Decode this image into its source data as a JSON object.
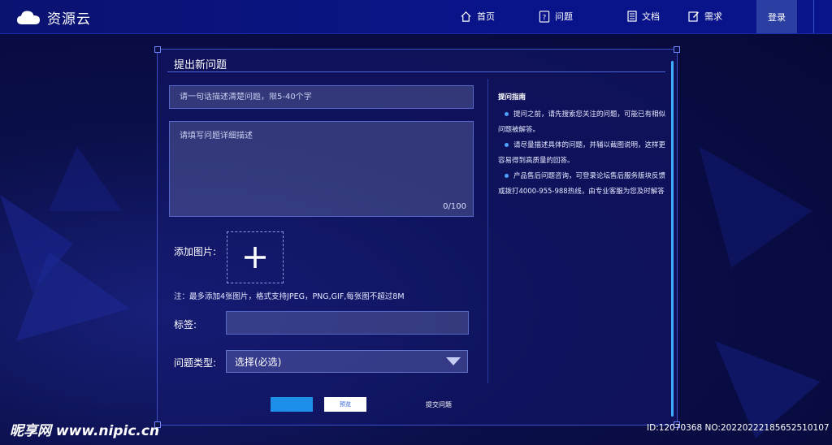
{
  "brand": {
    "name": "资源云"
  },
  "nav": {
    "items": [
      {
        "label": "首页",
        "icon": "home-icon"
      },
      {
        "label": "问题",
        "icon": "question-icon"
      },
      {
        "label": "文档",
        "icon": "document-icon"
      },
      {
        "label": "需求",
        "icon": "edit-icon"
      }
    ],
    "login_label": "登录"
  },
  "form": {
    "title": "提出新问题",
    "title_placeholder": "请一句话描述清楚问题，限5-40个字",
    "detail_placeholder": "请填写问题详细描述",
    "detail_counter": "0/100",
    "add_image_label": "添加图片:",
    "image_note": "注：最多添加4张图片，格式支持JPEG，PNG,GIF,每张图不超过8M",
    "tag_label": "标签:",
    "type_label": "问题类型:",
    "type_selected": "选择(必选)",
    "preview_label": "预览",
    "submit_label": "提交问题"
  },
  "guide": {
    "title": "提问指南",
    "items": [
      "提问之前，请先搜索您关注的问题，可能已有相似问题被解答。",
      "请尽量描述具体的问题，并辅以截图说明，这样更容易得到高质量的回答。",
      "产品售后问题咨询，可登录论坛售后服务版块反馈或拨打4000-955-988热线，由专业客服为您及时解答"
    ]
  },
  "watermark": {
    "left": "昵享网 www.nipic.cn",
    "right": "ID:12070368 NO:20220222185652510107"
  },
  "colors": {
    "accent": "#1e8fe8",
    "topbar": "#0a148a",
    "login_bg": "#2b3fa3",
    "panel_border": "#3c4fc2"
  }
}
